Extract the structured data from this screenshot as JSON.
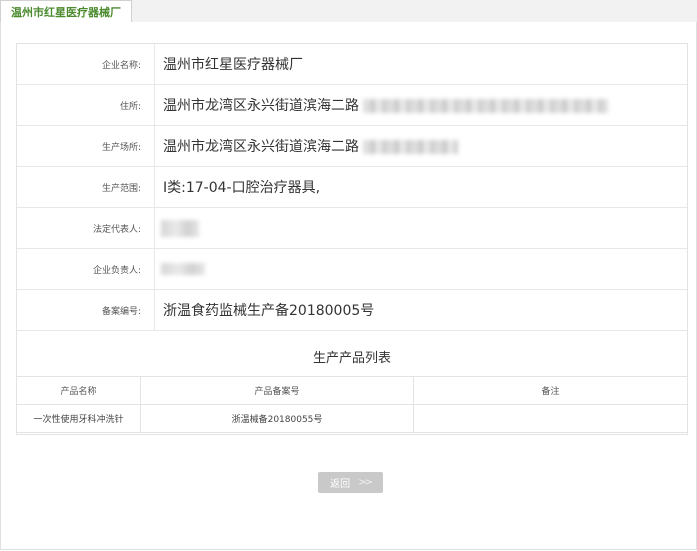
{
  "tab": {
    "label": "温州市红星医疗器械厂"
  },
  "info": {
    "rows": [
      {
        "label": "企业名称:",
        "value": "温州市红星医疗器械厂"
      },
      {
        "label": "住所:",
        "value": "温州市龙湾区永兴街道滨海二路"
      },
      {
        "label": "生产场所:",
        "value": "温州市龙湾区永兴街道滨海二路"
      },
      {
        "label": "生产范围:",
        "value": "Ⅰ类:17-04-口腔治疗器具,"
      },
      {
        "label": "法定代表人:",
        "value": ""
      },
      {
        "label": "企业负责人:",
        "value": ""
      },
      {
        "label": "备案编号:",
        "value": "浙温食药监械生产备20180005号"
      }
    ]
  },
  "products": {
    "title": "生产产品列表",
    "headers": [
      "产品名称",
      "产品备案号",
      "备注"
    ],
    "rows": [
      {
        "name": "一次性使用牙科冲洗针",
        "record_no": "浙温械备20180055号",
        "remark": ""
      }
    ]
  },
  "back_button": {
    "label": "返回",
    "chevron": ">>"
  }
}
